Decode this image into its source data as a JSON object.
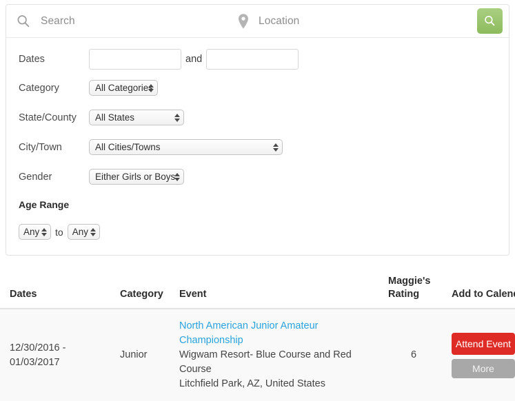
{
  "search": {
    "search_icon": "search-icon",
    "search_placeholder": "Search",
    "location_icon": "location-pin-icon",
    "location_placeholder": "Location",
    "search_value": "",
    "location_value": "",
    "submit_icon": "search-icon",
    "submit_color": "#96c46c"
  },
  "filters": {
    "dates_label": "Dates",
    "date_from_value": "",
    "date_to_value": "",
    "date_from_placeholder": "",
    "date_to_placeholder": "",
    "and_label": "and",
    "category_label": "Category",
    "category_value": "All Categories",
    "state_label": "State/County",
    "state_value": "All States",
    "city_label": "City/Town",
    "city_value": "All Cities/Towns",
    "gender_label": "Gender",
    "gender_value": "Either Girls or Boys",
    "age_range_label": "Age Range",
    "age_min_value": "Any",
    "age_max_value": "Any",
    "to_label": "to"
  },
  "table": {
    "headers": {
      "dates": "Dates",
      "category": "Category",
      "event": "Event",
      "rating": "Maggie's Rating",
      "add": "Add to Calendar"
    },
    "rows": [
      {
        "dates": "12/30/2016 - 01/03/2017",
        "category": "Junior",
        "event_name": "North American Junior Amateur Championship",
        "event_venue": "Wigwam Resort- Blue Course and Red Course",
        "event_location": "Litchfield Park, AZ, United States",
        "rating": "6",
        "attend_label": "Attend Event",
        "more_label": "More",
        "attend_color": "#df2b26",
        "more_color": "#a8a8a8"
      }
    ]
  }
}
